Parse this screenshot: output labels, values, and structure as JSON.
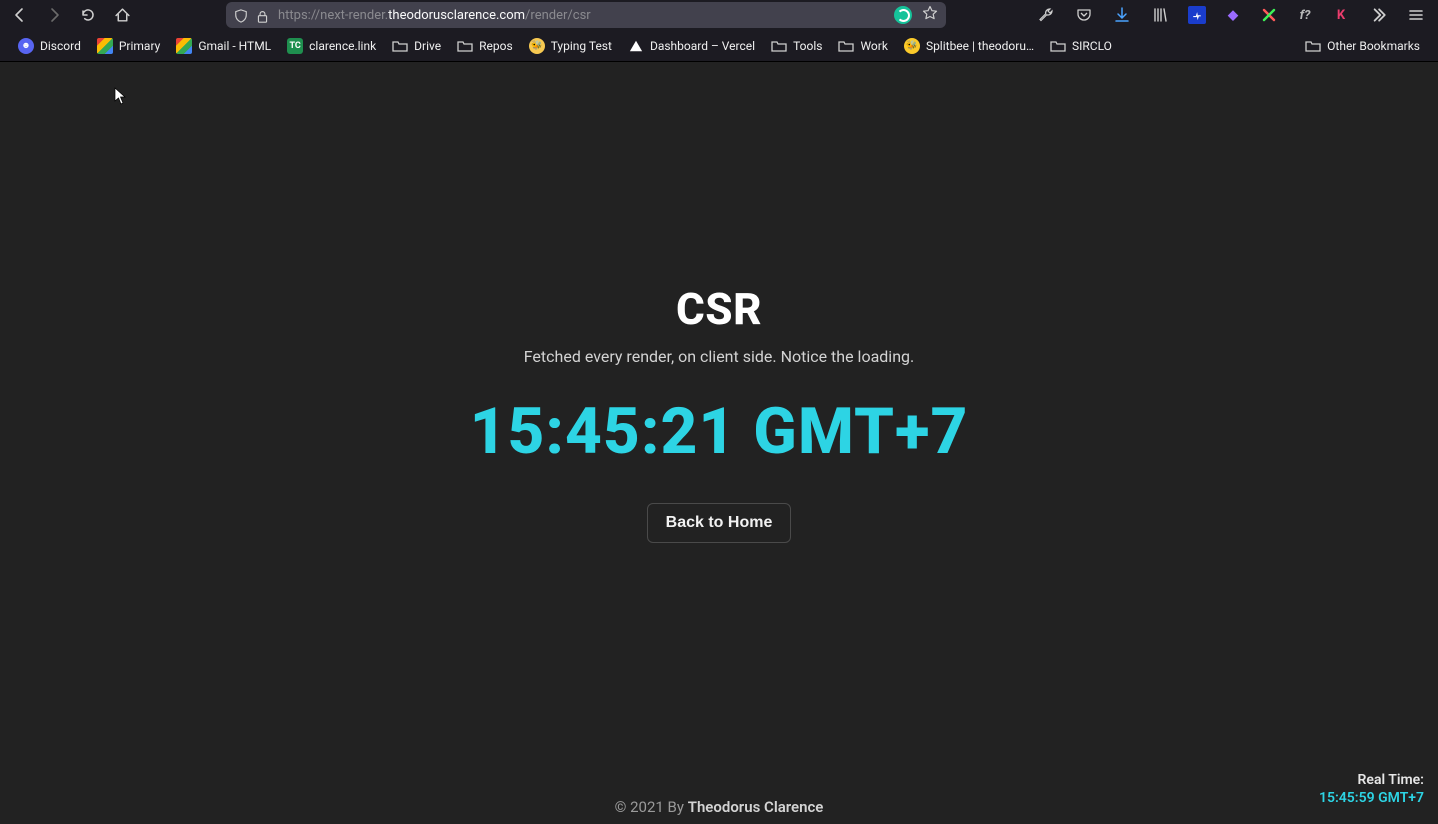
{
  "browser": {
    "url_protocol": "https://",
    "url_sub": "next-render.",
    "url_host": "theodorusclarence.com",
    "url_path": "/render/csr"
  },
  "bookmarks": {
    "items": [
      {
        "label": "Discord",
        "icon": "discord"
      },
      {
        "label": "Primary",
        "icon": "gmail"
      },
      {
        "label": "Gmail - HTML",
        "icon": "gmail"
      },
      {
        "label": "clarence.link",
        "icon": "tc"
      },
      {
        "label": "Drive",
        "icon": "folder"
      },
      {
        "label": "Repos",
        "icon": "folder"
      },
      {
        "label": "Typing Test",
        "icon": "typing"
      },
      {
        "label": "Dashboard – Vercel",
        "icon": "vercel"
      },
      {
        "label": "Tools",
        "icon": "folder"
      },
      {
        "label": "Work",
        "icon": "folder"
      },
      {
        "label": "Splitbee | theodoru…",
        "icon": "splitbee"
      },
      {
        "label": "SIRCLO",
        "icon": "folder"
      }
    ],
    "other": "Other Bookmarks"
  },
  "page": {
    "title": "CSR",
    "subtitle": "Fetched every render, on client side. Notice the loading.",
    "time": "15:45:21 GMT+7",
    "back_label": "Back to Home",
    "footer_prefix": "© 2021 By ",
    "footer_author": "Theodorus Clarence",
    "realtime_label": "Real Time:",
    "realtime_value": "15:45:59 GMT+7"
  }
}
